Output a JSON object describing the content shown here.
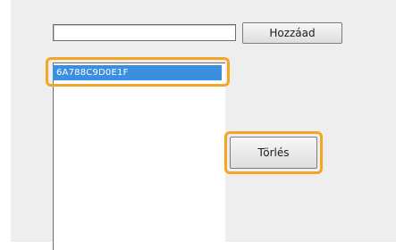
{
  "form": {
    "input_value": "",
    "add_label": "Hozzáad",
    "list_items": [
      "6A788C9D0E1F"
    ],
    "selected_item_index": 0,
    "delete_label": "Törlés"
  },
  "colors": {
    "highlight": "#f4a623",
    "selection": "#3b8fe0"
  }
}
